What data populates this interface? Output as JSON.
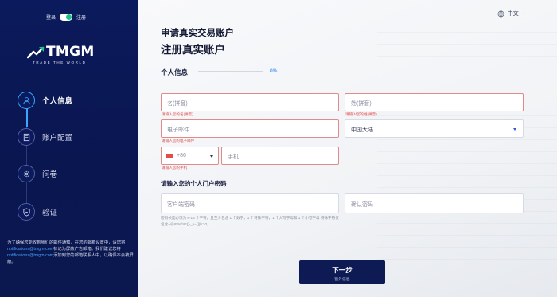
{
  "sidebar": {
    "toggle": {
      "left_label": "登录",
      "right_label": "注册",
      "state": "on"
    },
    "logo": {
      "text": "TMGM",
      "tagline": "TRADE THE WORLD"
    },
    "steps": [
      {
        "label": "个人信息",
        "icon": "user-icon",
        "active": true
      },
      {
        "label": "账户配置",
        "icon": "document-icon",
        "active": false
      },
      {
        "label": "问卷",
        "icon": "gear-icon",
        "active": false
      },
      {
        "label": "验证",
        "icon": "shield-lock-icon",
        "active": false
      }
    ],
    "notice": {
      "part1": "为了确保您能收到我们的邮件通知，在您的邮箱设置中，请您将",
      "email1": "notifications@tmgm.com",
      "part2": "标记为屏蔽广告邮箱。我们建议您将",
      "email2": "notifications@tmgm.com",
      "part3": "添加到您的邮箱联系人中，以确保不会被屏蔽。"
    }
  },
  "main": {
    "language": "中文",
    "heading1": "申请真实交易账户",
    "heading2": "注册真实账户",
    "section_title": "个人信息",
    "progress": {
      "percent_label": "0%",
      "value": 0
    },
    "fields": {
      "first_name": {
        "placeholder": "名(拼音)",
        "error": "请输入您的名(拼音)"
      },
      "last_name": {
        "placeholder": "姓(拼音)",
        "error": "请输入您的姓(拼音)"
      },
      "email": {
        "placeholder": "电子邮件",
        "error": "请输入您的电子邮件"
      },
      "country": {
        "value": "中国大陆"
      },
      "phone_code": {
        "value": "+86"
      },
      "phone": {
        "placeholder": "手机",
        "error": "请输入您的手机"
      },
      "password": {
        "placeholder": "客户端密码"
      },
      "confirm_password": {
        "placeholder": "确认密码"
      }
    },
    "password_title": "请输入您的个人门户密码",
    "password_hint": "密码长度必须为 8-15 个字符，且至少包含 1 个数字，1 个特殊字符，1 个大写字母和 1 个小写字母 特殊字符仅包含~@#$%^&*()-_+=[]|\\<>?,.",
    "next_button": {
      "label": "下一步",
      "sublabel": "额外信息"
    }
  },
  "colors": {
    "sidebar_bg": "#0b1a5c",
    "accent_blue": "#1c7ef0",
    "error_red": "#e25050",
    "button_bg": "#0e1a54",
    "toggle_green": "#1ec28b"
  }
}
